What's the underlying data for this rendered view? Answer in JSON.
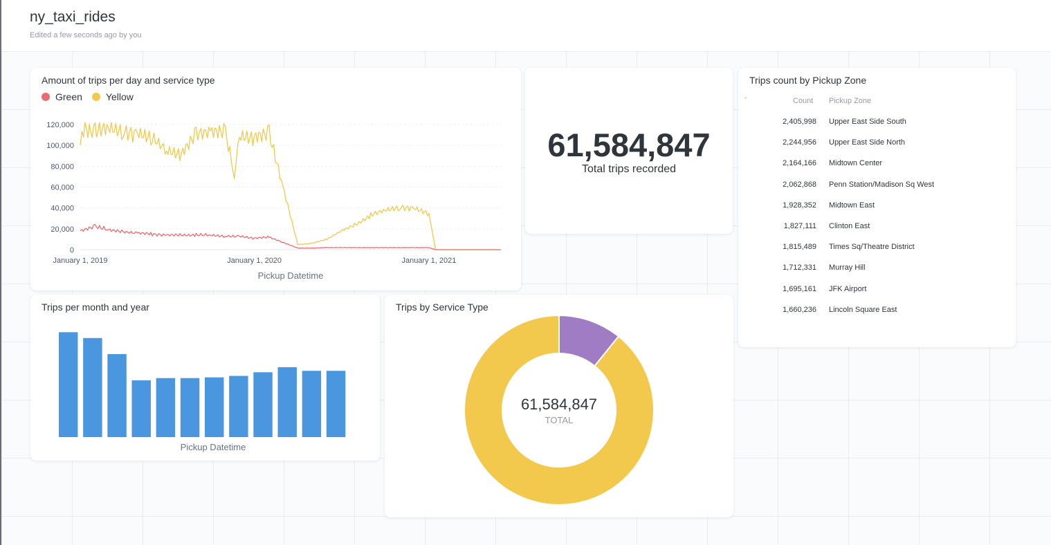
{
  "dashboard": {
    "title": "ny_taxi_rides",
    "subtitle": "Edited a few seconds ago by you"
  },
  "colors": {
    "green": "#ea6c73",
    "yellow": "#f2c94c",
    "blue": "#4a96df",
    "purple": "#a07cc4",
    "text": "#2e353b",
    "muted": "#949aab"
  },
  "cards": {
    "line": {
      "title": "Amount of trips per day and service type"
    },
    "scalar": {
      "value": "61,584,847",
      "label": "Total trips recorded"
    },
    "table": {
      "title": "Trips count by Pickup Zone"
    },
    "bar": {
      "title": "Trips per month and year"
    },
    "donut": {
      "title": "Trips by Service Type",
      "center_value": "61,584,847",
      "center_label": "TOTAL"
    }
  },
  "chart_data": [
    {
      "type": "line",
      "title": "Amount of trips per day and service type",
      "xlabel": "Pickup Datetime",
      "ylabel": "",
      "ylim": [
        0,
        120000
      ],
      "yticks": [
        "0",
        "20,000",
        "40,000",
        "60,000",
        "80,000",
        "100,000",
        "120,000"
      ],
      "xticks": [
        "January 1, 2019",
        "January 1, 2020",
        "January 1, 2021"
      ],
      "legend_position": "top-left",
      "series": [
        {
          "name": "Green",
          "color": "#ea6c73",
          "points": [
            [
              "2019-01",
              18000
            ],
            [
              "2019-02",
              22000
            ],
            [
              "2019-03",
              19000
            ],
            [
              "2019-04",
              17000
            ],
            [
              "2019-05",
              16000
            ],
            [
              "2019-06",
              15000
            ],
            [
              "2019-07",
              14000
            ],
            [
              "2019-08",
              14000
            ],
            [
              "2019-09",
              14000
            ],
            [
              "2019-10",
              14000
            ],
            [
              "2019-11",
              13000
            ],
            [
              "2019-12",
              13000
            ],
            [
              "2020-01",
              11000
            ],
            [
              "2020-02",
              12000
            ],
            [
              "2020-03",
              7000
            ],
            [
              "2020-04",
              1500
            ],
            [
              "2020-05",
              1500
            ],
            [
              "2020-06",
              2000
            ],
            [
              "2020-08",
              2000
            ],
            [
              "2020-12",
              2000
            ],
            [
              "2021-01",
              2000
            ],
            [
              "2021-01-15",
              0
            ],
            [
              "2021-06",
              0
            ]
          ]
        },
        {
          "name": "Yellow",
          "color": "#f2c94c",
          "points": [
            [
              "2019-01",
              100000
            ],
            [
              "2019-01-08",
              118000
            ],
            [
              "2019-02",
              112000
            ],
            [
              "2019-03",
              117000
            ],
            [
              "2019-04",
              114000
            ],
            [
              "2019-05",
              112000
            ],
            [
              "2019-06",
              108000
            ],
            [
              "2019-07",
              95000
            ],
            [
              "2019-08",
              92000
            ],
            [
              "2019-09",
              110000
            ],
            [
              "2019-10",
              113000
            ],
            [
              "2019-11",
              112000
            ],
            [
              "2019-11-20",
              72000
            ],
            [
              "2019-12",
              109000
            ],
            [
              "2020-01",
              108000
            ],
            [
              "2020-02",
              110000
            ],
            [
              "2020-03",
              60000
            ],
            [
              "2020-04",
              5000
            ],
            [
              "2020-05",
              6000
            ],
            [
              "2020-06",
              10000
            ],
            [
              "2020-07",
              18000
            ],
            [
              "2020-08",
              24000
            ],
            [
              "2020-09",
              33000
            ],
            [
              "2020-10",
              38000
            ],
            [
              "2020-11",
              41000
            ],
            [
              "2020-12",
              40000
            ],
            [
              "2021-01",
              35000
            ],
            [
              "2021-01-15",
              0
            ],
            [
              "2021-06",
              0
            ]
          ]
        }
      ]
    },
    {
      "type": "bar",
      "title": "Trips per month and year",
      "xlabel": "Pickup Datetime",
      "values": [
        7200000,
        6800000,
        5700000,
        3900000,
        4050000,
        4050000,
        4100000,
        4200000,
        4450000,
        4800000,
        4550000,
        4550000
      ],
      "ylim": [
        0,
        7500000
      ],
      "color": "#4a96df"
    },
    {
      "type": "pie",
      "title": "Trips by Service Type",
      "total_label": "TOTAL",
      "total": "61,584,847",
      "slices": [
        {
          "value": 10.8,
          "color": "#a07cc4"
        },
        {
          "value": 89.2,
          "color": "#f2c94c"
        }
      ]
    },
    {
      "type": "table",
      "title": "Trips count by Pickup Zone",
      "columns": [
        "Count",
        "Pickup Zone"
      ],
      "rows": [
        [
          "2,405,998",
          "Upper East Side South"
        ],
        [
          "2,244,956",
          "Upper East Side North"
        ],
        [
          "2,164,166",
          "Midtown Center"
        ],
        [
          "2,062,868",
          "Penn Station/Madison Sq West"
        ],
        [
          "1,928,352",
          "Midtown East"
        ],
        [
          "1,827,111",
          "Clinton East"
        ],
        [
          "1,815,489",
          "Times Sq/Theatre District"
        ],
        [
          "1,712,331",
          "Murray Hill"
        ],
        [
          "1,695,161",
          "JFK Airport"
        ],
        [
          "1,660,236",
          "Lincoln Square East"
        ]
      ]
    }
  ]
}
